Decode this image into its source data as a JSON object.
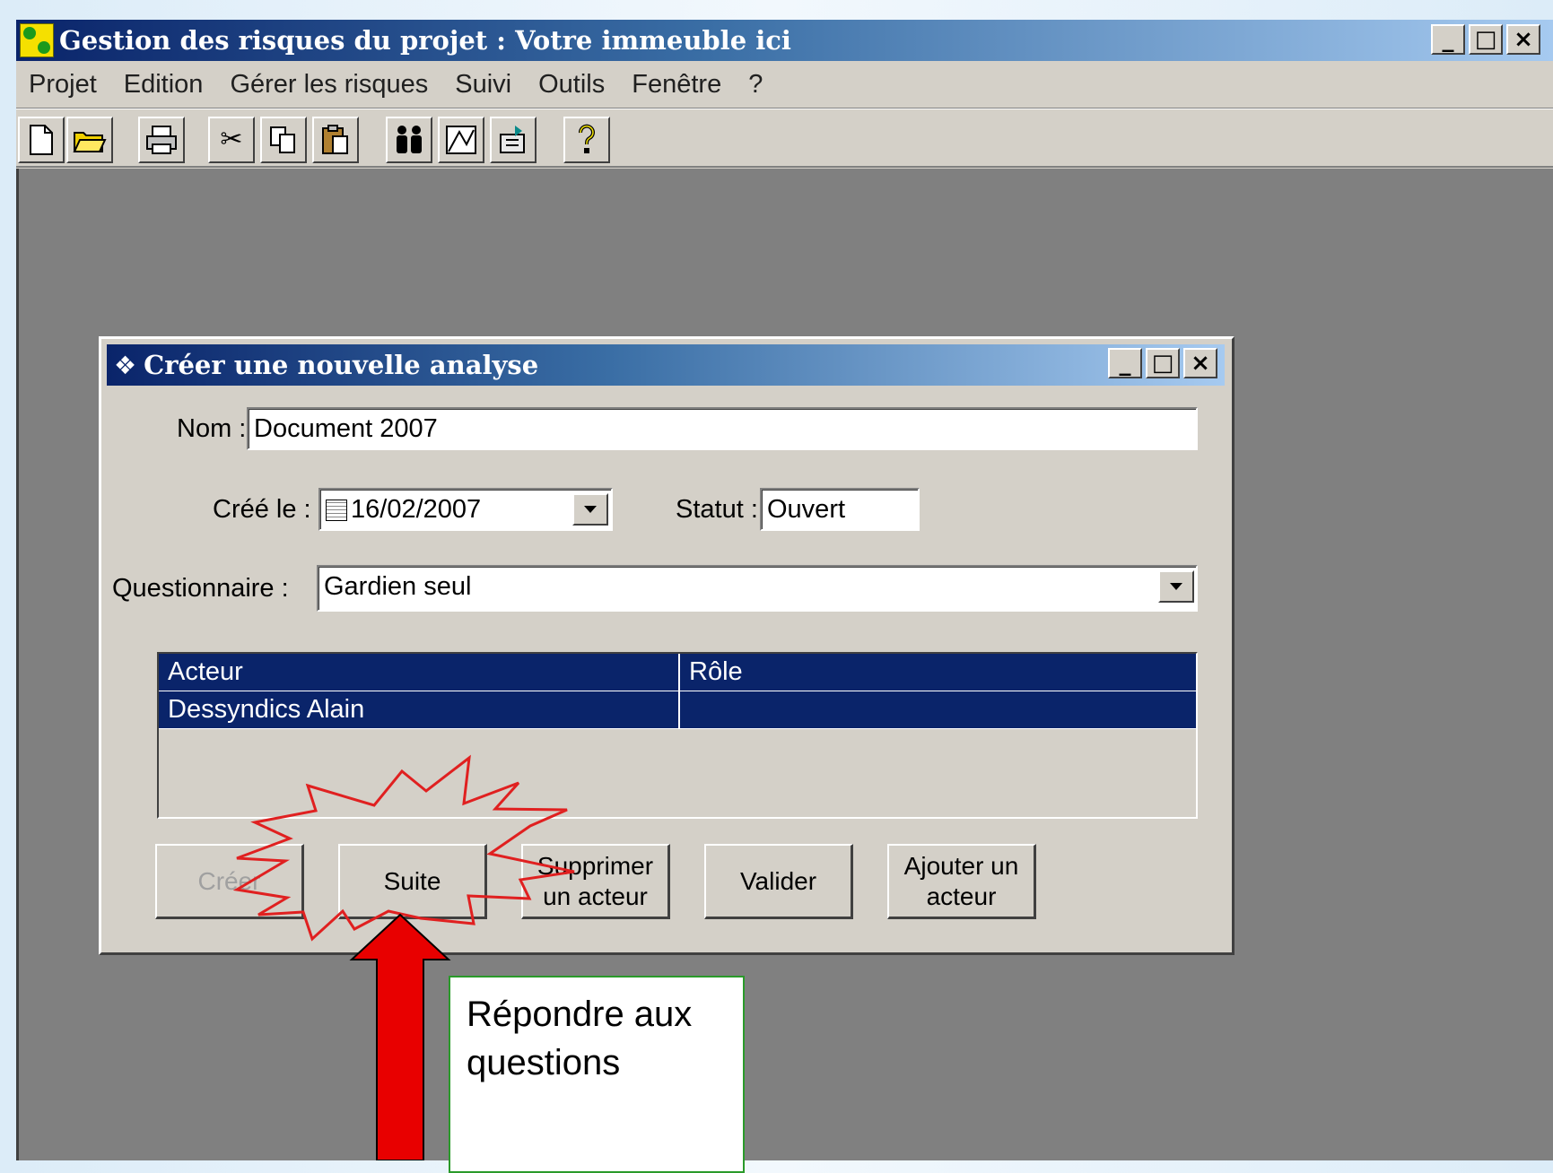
{
  "window": {
    "title": "Gestion des risques du projet : Votre immeuble ici",
    "controls": [
      "_",
      "□",
      "×"
    ]
  },
  "menu": [
    "Projet",
    "Edition",
    "Gérer les risques",
    "Suivi",
    "Outils",
    "Fenêtre",
    "?"
  ],
  "toolbar": {
    "icons": [
      "new-document-icon",
      "open-folder-icon",
      "print-icon",
      "cut-icon",
      "copy-icon",
      "paste-icon",
      "actors-icon",
      "chart-icon",
      "export-icon",
      "help-icon"
    ]
  },
  "dialog": {
    "title": "Créer une nouvelle analyse",
    "nom_label": "Nom :",
    "nom_value": "Document 2007",
    "cree_label": "Créé le :",
    "cree_value": "16/02/2007",
    "statut_label": "Statut :",
    "statut_value": "Ouvert",
    "questionnaire_label": "Questionnaire :",
    "questionnaire_value": "Gardien seul",
    "grid": {
      "headers": [
        "Acteur",
        "Rôle"
      ],
      "rows": [
        [
          "Dessyndics Alain",
          ""
        ]
      ]
    },
    "buttons": {
      "creer": "Créer",
      "suite": "Suite",
      "supprimer_line1": "Supprimer",
      "supprimer_line2": "un acteur",
      "valider": "Valider",
      "ajouter_line1": "Ajouter un",
      "ajouter_line2": "acteur"
    }
  },
  "annotation": {
    "callout_line1": "Répondre aux",
    "callout_line2": "questions",
    "colors": {
      "burst": "#e02020",
      "arrow": "#e80000",
      "callout_border": "#2a9a2a"
    }
  }
}
